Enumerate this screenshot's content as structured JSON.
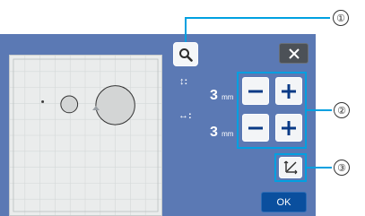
{
  "preview": {
    "circle_shapes": [
      "small-circle",
      "medium-circle",
      "large-circle"
    ]
  },
  "toolbar": {
    "zoom_icon": "magnifier-icon",
    "close_icon": "close-icon"
  },
  "height": {
    "icon_symbol": "↕:",
    "value": "3",
    "unit": "mm"
  },
  "width": {
    "icon_symbol": "↔:",
    "value": "3",
    "unit": "mm"
  },
  "buttons": {
    "minus_symbol": "−",
    "plus_symbol": "+",
    "ratio_icon": "aspect-ratio-lock-icon",
    "ok_label": "OK"
  },
  "callouts": {
    "one": "①",
    "two": "②",
    "three": "③"
  },
  "colors": {
    "panel_blue": "#5b79b4",
    "highlight": "#00a0e0",
    "ok_button": "#0a4f9e",
    "close_button": "#4c5157"
  }
}
